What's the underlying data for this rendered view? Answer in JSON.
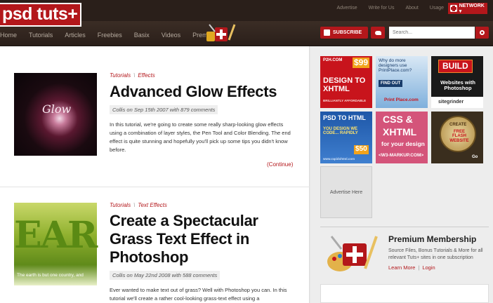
{
  "header": {
    "logo": "psd tuts+",
    "top_links": [
      "Advertise",
      "Write for Us",
      "About",
      "Usage"
    ],
    "network_label": "NETWORK ▾"
  },
  "nav": {
    "items": [
      "Home",
      "Tutorials",
      "Articles",
      "Freebies",
      "Basix",
      "Videos",
      "Premium"
    ],
    "subscribe_label": "SUBSCRIBE",
    "search_placeholder": "Search..."
  },
  "posts": [
    {
      "categories": [
        "Tutorials",
        "Effects"
      ],
      "title": "Advanced Glow Effects",
      "meta": "Collis on Sep 15th 2007 with 879 comments",
      "excerpt": "In this tutorial, we're going to create some really sharp-looking glow effects using a combination of layer styles, the Pen Tool and Color Blending. The end effect is quite stunning and hopefully you'll pick up some tips you didn't know before.",
      "continue_label": "(Continue)",
      "thumb_text": "Glow"
    },
    {
      "categories": [
        "Tutorials",
        "Text Effects"
      ],
      "title": "Create a Spectacular Grass Text Effect in Photoshop",
      "meta": "Collis on May 22nd 2008 with 588 comments",
      "excerpt": "Ever wanted to make text out of grass? Well with Photoshop you can. In this tutorial we'll create a rather cool-looking grass-text effect using a",
      "thumb_text": "EAR",
      "thumb_caption": "The earth is but one country, and"
    }
  ],
  "sidebar": {
    "ads": [
      {
        "line1": "P2H.COM",
        "price": "$99",
        "line2": "DESIGN TO XHTML",
        "line3": "BRILLIANTLY AFFORDABLE"
      },
      {
        "line1": "Why do more designers use PrintPlace.com?",
        "line2": "FIND OUT",
        "line3": "Print Place.com"
      },
      {
        "line1": "BUILD",
        "line2": "Websites with Photoshop",
        "line3": "sitegrinder"
      },
      {
        "line1": "PSD TO HTML",
        "line2": "YOU DESIGN WE CODE... RAPIDLY",
        "price": "$50",
        "line3": "www.rapidxhtml.com"
      },
      {
        "line1": "CSS &",
        "line2": "XHTML",
        "line3": "for your design",
        "line4": "<W3-MARKUP.COM>"
      },
      {
        "line1": "CREATE",
        "line2": "FREE FLASH WEBSITE",
        "line3": "Go"
      }
    ],
    "advertise_here": "Advertise Here",
    "premium": {
      "title": "Premium Membership",
      "description": "Source Files, Bonus Tutorials & More for all relevant Tuts+ sites in one subscription",
      "learn_more": "Learn More",
      "login": "Login"
    }
  },
  "colors": {
    "brand_red": "#b3171b",
    "header_dark": "#2a1f1a"
  }
}
